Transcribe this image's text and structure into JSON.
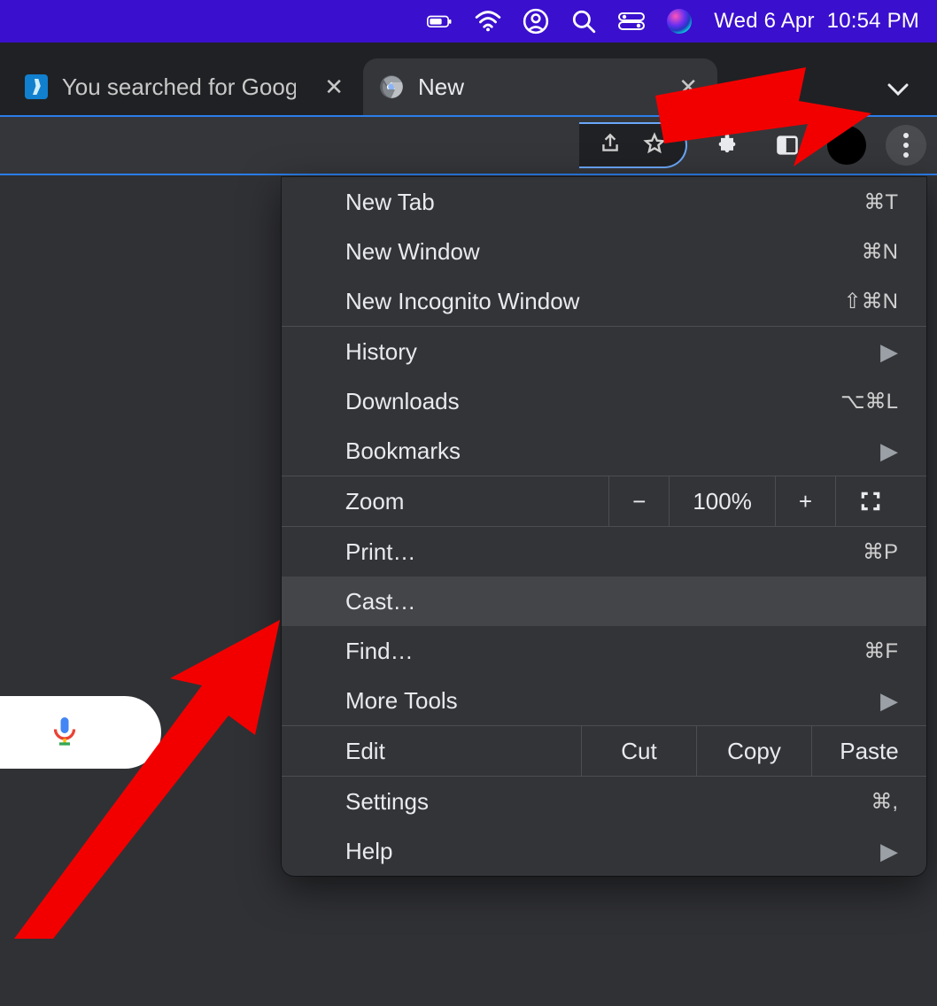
{
  "menubar": {
    "date": "Wed 6 Apr",
    "time": "10:54 PM"
  },
  "tabs": [
    {
      "title": "You searched for Google",
      "active": false
    },
    {
      "title": "New Tab",
      "active": true
    }
  ],
  "menu": {
    "new_tab": {
      "label": "New Tab",
      "shortcut": "⌘T"
    },
    "new_window": {
      "label": "New Window",
      "shortcut": "⌘N"
    },
    "incognito": {
      "label": "New Incognito Window",
      "shortcut": "⇧⌘N"
    },
    "history": {
      "label": "History"
    },
    "downloads": {
      "label": "Downloads",
      "shortcut": "⌥⌘L"
    },
    "bookmarks": {
      "label": "Bookmarks"
    },
    "zoom": {
      "label": "Zoom",
      "minus": "−",
      "value": "100%",
      "plus": "+"
    },
    "print": {
      "label": "Print…",
      "shortcut": "⌘P"
    },
    "cast": {
      "label": "Cast…"
    },
    "find": {
      "label": "Find…",
      "shortcut": "⌘F"
    },
    "more_tools": {
      "label": "More Tools"
    },
    "edit": {
      "label": "Edit",
      "cut": "Cut",
      "copy": "Copy",
      "paste": "Paste"
    },
    "settings": {
      "label": "Settings",
      "shortcut": "⌘,"
    },
    "help": {
      "label": "Help"
    }
  }
}
